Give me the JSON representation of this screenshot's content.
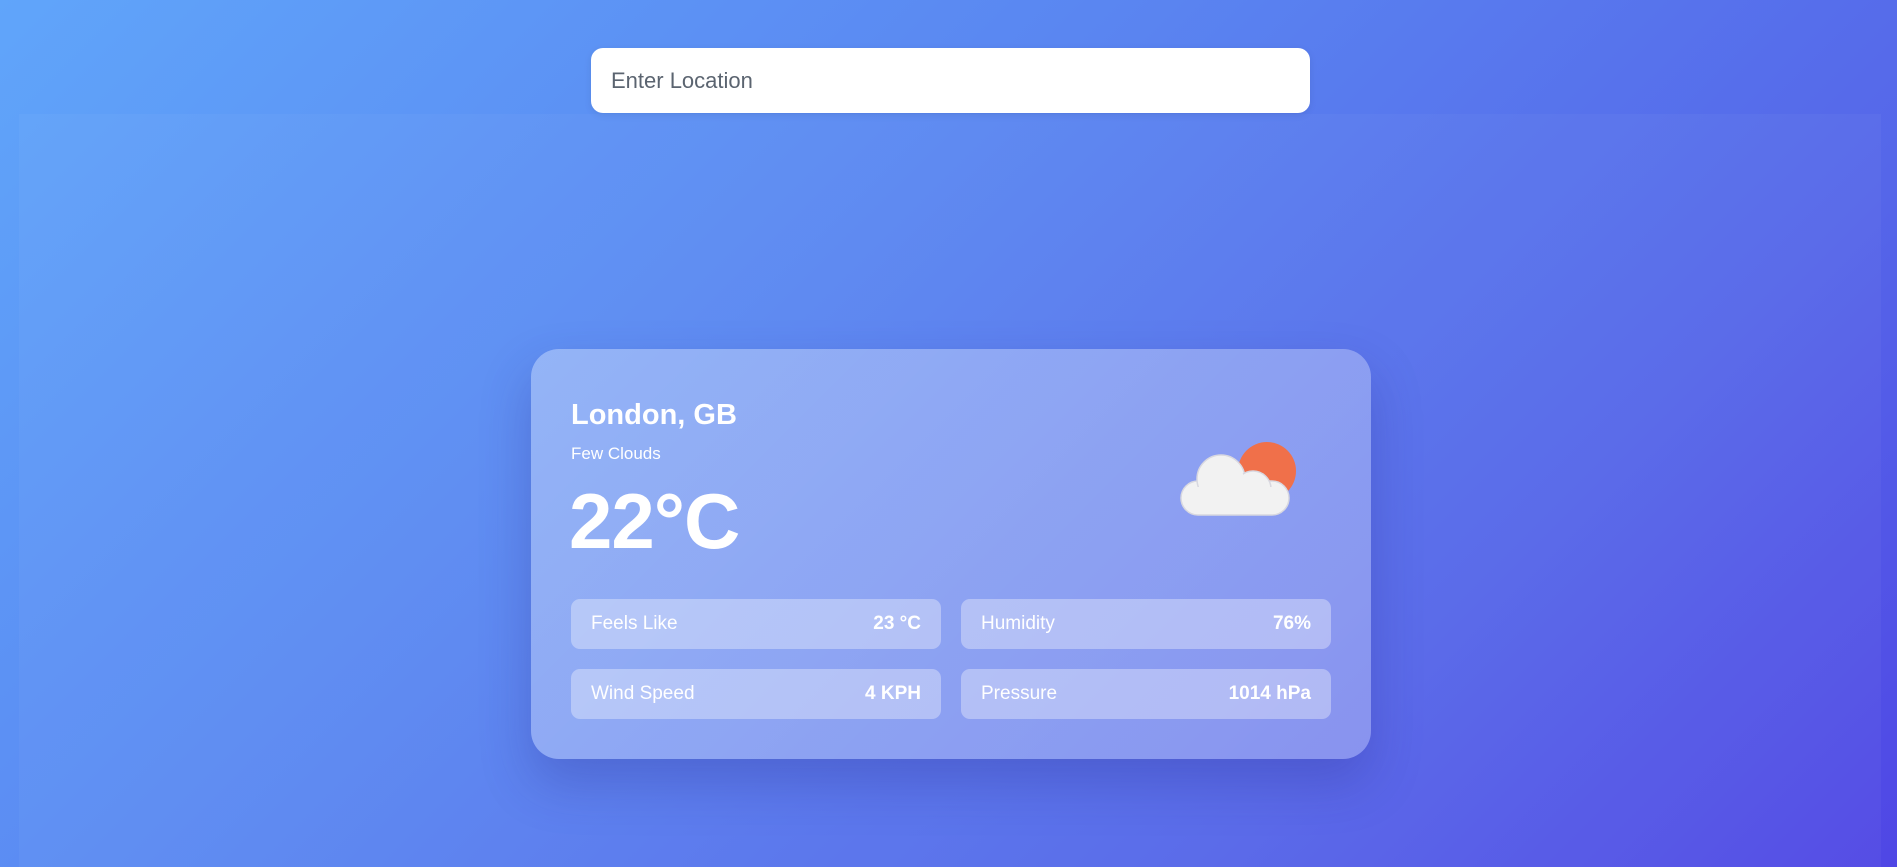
{
  "search": {
    "placeholder": "Enter Location",
    "value": ""
  },
  "weather": {
    "location": "London, GB",
    "condition": "Few Clouds",
    "temperature": "22°C",
    "icon": "few-clouds-icon",
    "stats": [
      {
        "label": "Feels Like",
        "value": "23 °C"
      },
      {
        "label": "Humidity",
        "value": "76%"
      },
      {
        "label": "Wind Speed",
        "value": "4 KPH"
      },
      {
        "label": "Pressure",
        "value": "1014 hPa"
      }
    ]
  },
  "colors": {
    "background_start": "#60a5fa",
    "background_end": "#4f46e5",
    "sun": "#f0704a",
    "cloud": "#f2f2f2"
  }
}
